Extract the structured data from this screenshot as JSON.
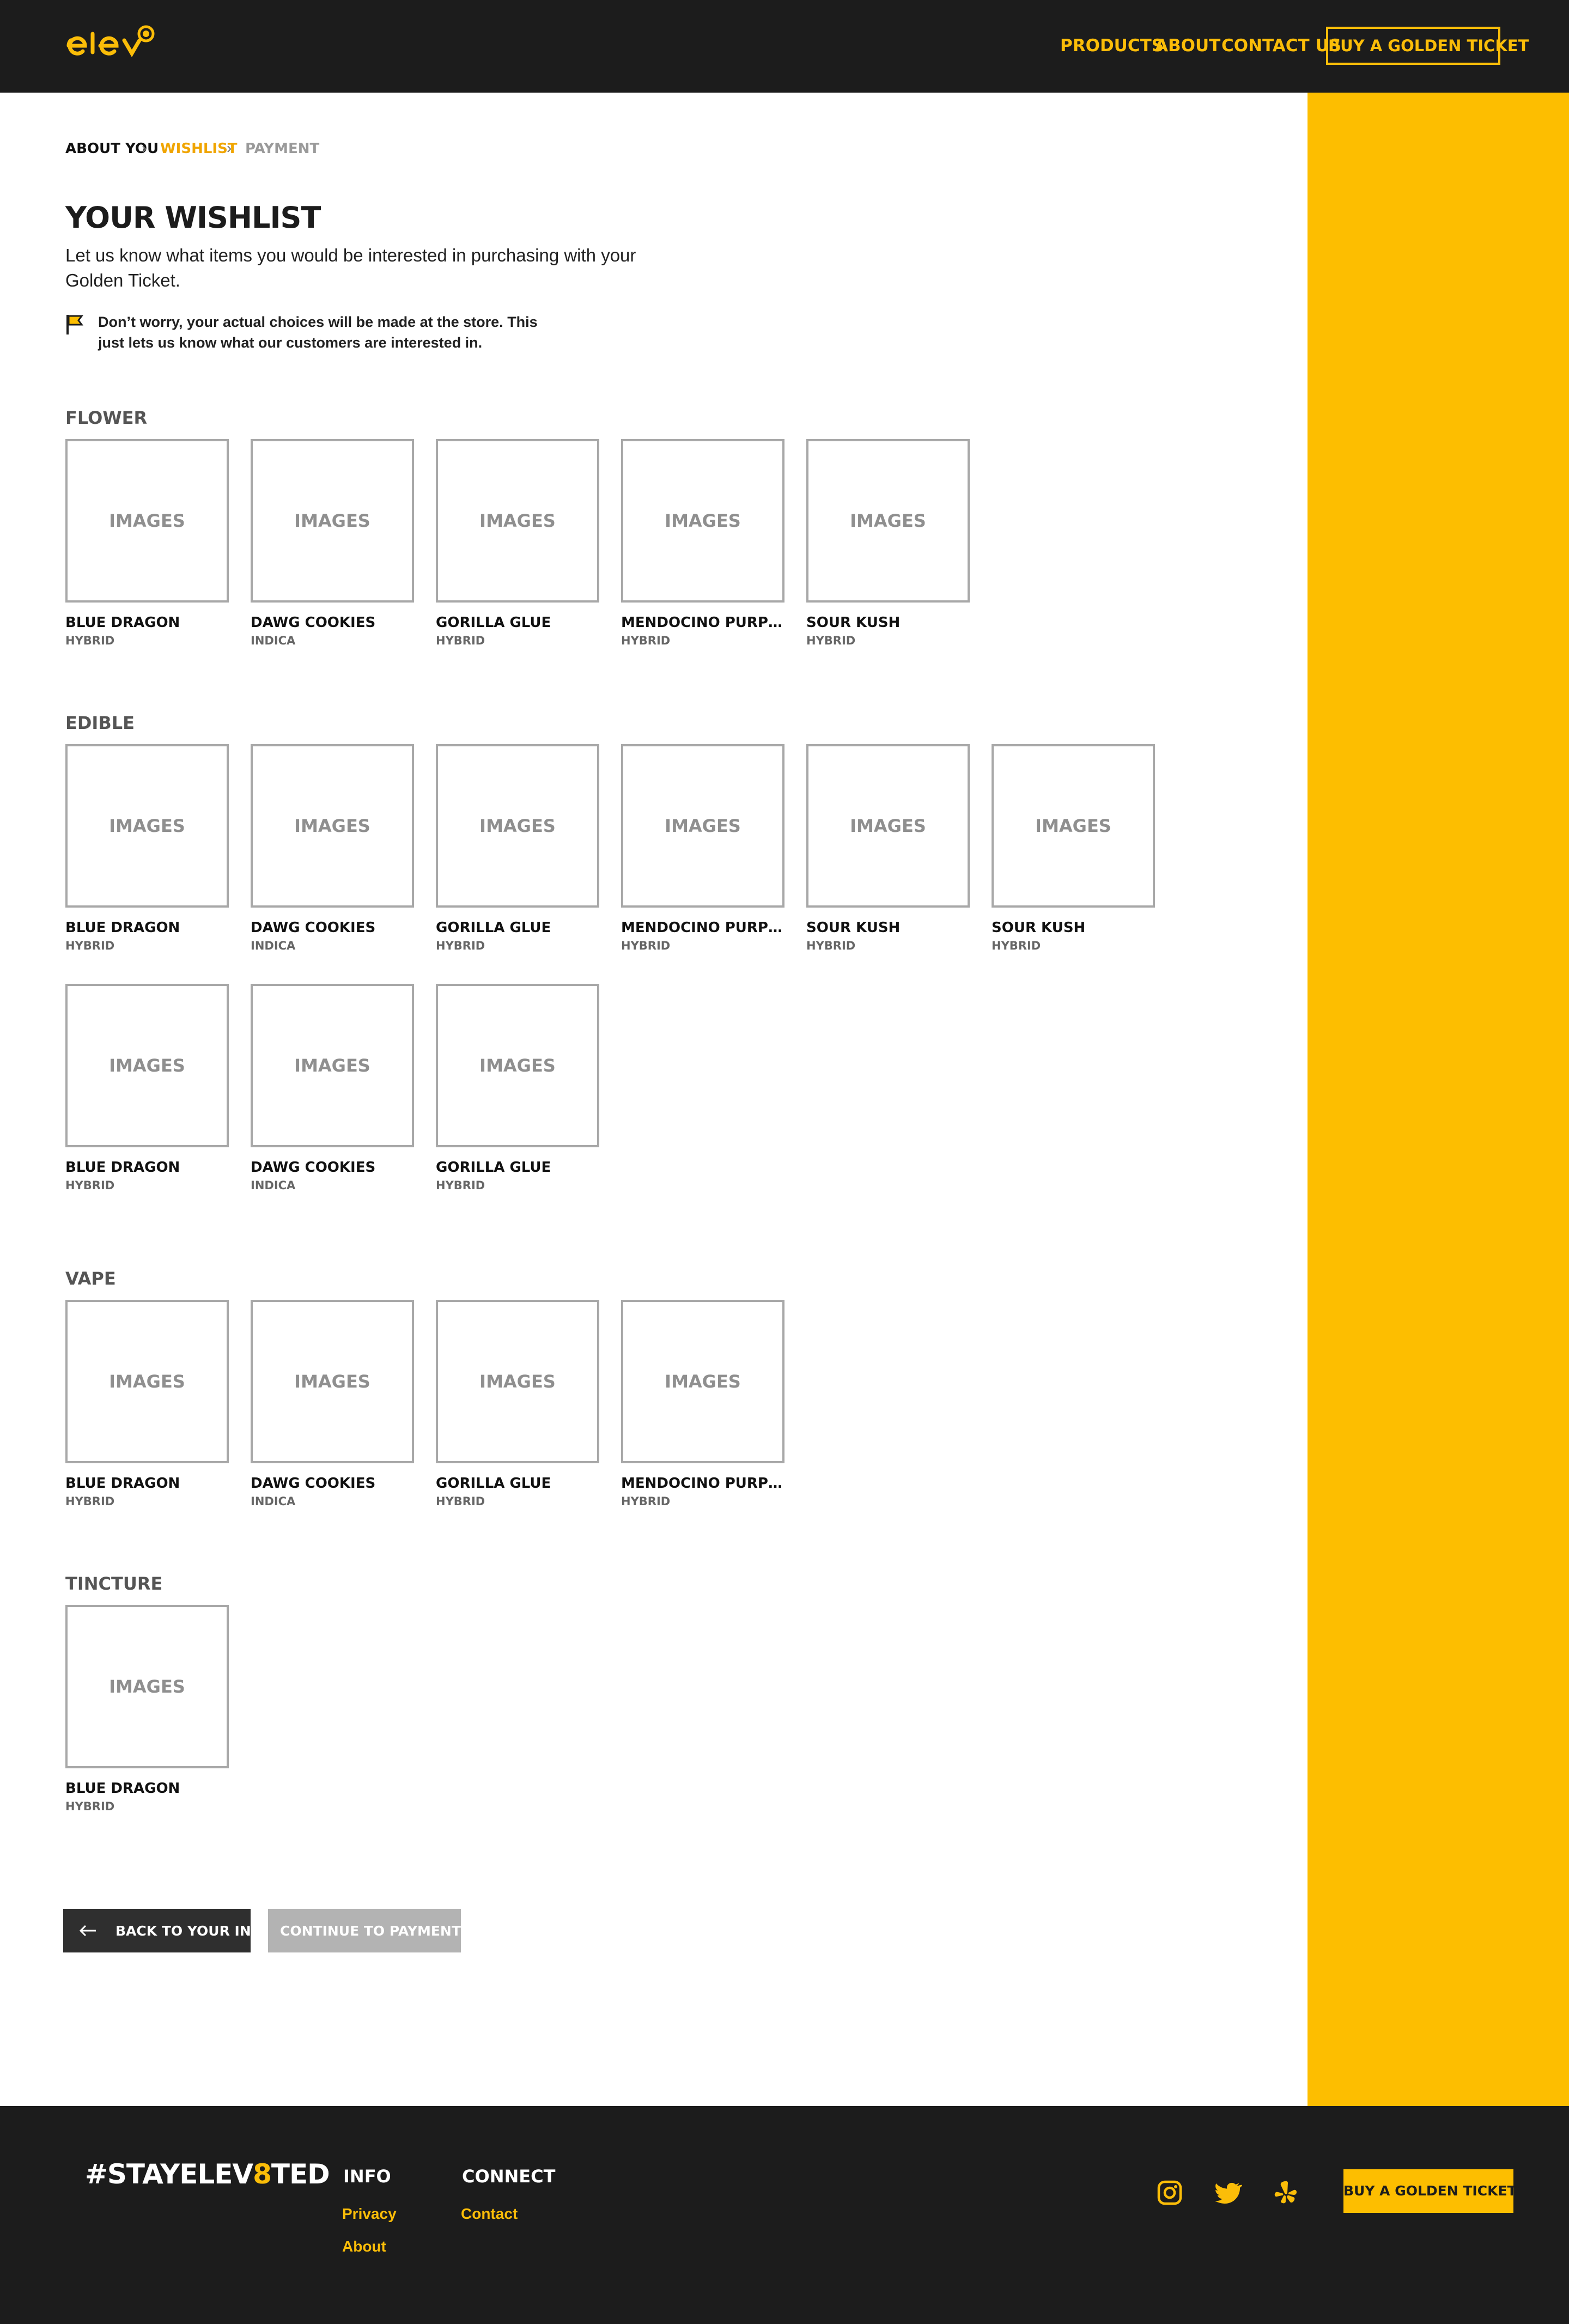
{
  "header": {
    "logo_text": "elev8",
    "nav": {
      "products": "PRODUCTS",
      "about": "ABOUT",
      "contact": "CONTACT US",
      "cta": "BUY A GOLDEN TICKET"
    }
  },
  "breadcrumb": {
    "step1": "ABOUT YOU",
    "step2": "WISHLIST",
    "step3": "PAYMENT"
  },
  "intro": {
    "title": "YOUR WISHLIST",
    "subtitle": "Let us know what items you would be interested in purchasing with your Golden Ticket.",
    "note": "Don’t worry, your actual choices will be made at the store. This just lets us know what our customers are interested in."
  },
  "sections": [
    {
      "title": "FLOWER",
      "items": [
        {
          "image": "IMAGES",
          "name": "BLUE DRAGON",
          "type": "HYBRID"
        },
        {
          "image": "IMAGES",
          "name": "DAWG COOKIES",
          "type": "INDICA"
        },
        {
          "image": "IMAGES",
          "name": "GORILLA GLUE",
          "type": "HYBRID"
        },
        {
          "image": "IMAGES",
          "name": "MENDOCINO PURPLE CH...",
          "type": "HYBRID"
        },
        {
          "image": "IMAGES",
          "name": "SOUR KUSH",
          "type": "HYBRID"
        }
      ]
    },
    {
      "title": "EDIBLE",
      "items": [
        {
          "image": "IMAGES",
          "name": "BLUE DRAGON",
          "type": "HYBRID"
        },
        {
          "image": "IMAGES",
          "name": "DAWG COOKIES",
          "type": "INDICA"
        },
        {
          "image": "IMAGES",
          "name": "GORILLA GLUE",
          "type": "HYBRID"
        },
        {
          "image": "IMAGES",
          "name": "MENDOCINO PURPLE CH...",
          "type": "HYBRID"
        },
        {
          "image": "IMAGES",
          "name": "SOUR KUSH",
          "type": "HYBRID"
        },
        {
          "image": "IMAGES",
          "name": "SOUR KUSH",
          "type": "HYBRID"
        },
        {
          "image": "IMAGES",
          "name": "BLUE DRAGON",
          "type": "HYBRID"
        },
        {
          "image": "IMAGES",
          "name": "DAWG COOKIES",
          "type": "INDICA"
        },
        {
          "image": "IMAGES",
          "name": "GORILLA GLUE",
          "type": "HYBRID"
        }
      ]
    },
    {
      "title": "VAPE",
      "items": [
        {
          "image": "IMAGES",
          "name": "BLUE DRAGON",
          "type": "HYBRID"
        },
        {
          "image": "IMAGES",
          "name": "DAWG COOKIES",
          "type": "INDICA"
        },
        {
          "image": "IMAGES",
          "name": "GORILLA GLUE",
          "type": "HYBRID"
        },
        {
          "image": "IMAGES",
          "name": "MENDOCINO PURPLE CH...",
          "type": "HYBRID"
        }
      ]
    },
    {
      "title": "TINCTURE",
      "items": [
        {
          "image": "IMAGES",
          "name": "BLUE DRAGON",
          "type": "HYBRID"
        }
      ]
    }
  ],
  "buttons": {
    "back": "BACK TO YOUR INFO",
    "continue": "CONTINUE TO PAYMENT"
  },
  "footer": {
    "hashtag_pre": "#STAYELEV",
    "hashtag_eight": "8",
    "hashtag_post": "TED",
    "info_heading": "INFO",
    "info_links": [
      "Privacy",
      "About"
    ],
    "connect_heading": "CONNECT",
    "connect_links": [
      "Contact"
    ],
    "social_icons": [
      "instagram-icon",
      "twitter-icon",
      "yelp-icon"
    ],
    "cta": "BUY A GOLDEN TICKET"
  },
  "colors": {
    "brand_yellow": "#fdbe00",
    "dark": "#1c1c1c",
    "breadcrumb_active": "#f0a500",
    "breadcrumb_inactive": "#9a9a9a"
  }
}
